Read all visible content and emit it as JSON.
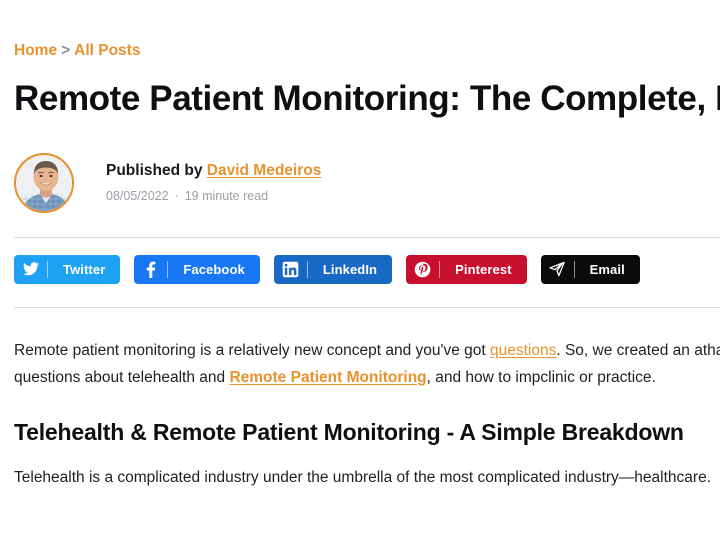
{
  "breadcrumb": {
    "home": "Home",
    "separator": ">",
    "all_posts": "All Posts",
    "link_color": "#e8912d"
  },
  "article": {
    "title": "Remote Patient Monitoring: The Complete, Everything You Need to Know Guide",
    "author": {
      "published_by": "Published by",
      "name": "David Medeiros",
      "avatar_alt": "David Medeiros"
    },
    "meta": {
      "date": "08/05/2022",
      "separator": "·",
      "read_time": "19 minute read"
    },
    "paragraph1": {
      "part1": "Remote patient monitoring is a relatively new concept and you've got ",
      "link1": "questions",
      "part2": ". So, we created an a",
      "part3": "that answers all of your questions about telehealth and ",
      "link2": "Remote Patient Monitoring",
      "part4": ", and how to imp",
      "part5": "clinic or practice."
    },
    "heading2": "Telehealth & Remote Patient Monitoring - A Simple Breakdown",
    "paragraph2": "Telehealth is a complicated industry under the umbrella of the most complicated industry—healthcare."
  },
  "share": {
    "buttons": [
      {
        "label": "Twitter",
        "icon": "twitter-icon",
        "color": "#1da1f2"
      },
      {
        "label": "Facebook",
        "icon": "facebook-icon",
        "color": "#1877f2"
      },
      {
        "label": "LinkedIn",
        "icon": "linkedin-icon",
        "color": "#1769c4"
      },
      {
        "label": "Pinterest",
        "icon": "pinterest-icon",
        "color": "#c8102e"
      },
      {
        "label": "Email",
        "icon": "send-icon",
        "color": "#0b0b0b"
      }
    ]
  }
}
